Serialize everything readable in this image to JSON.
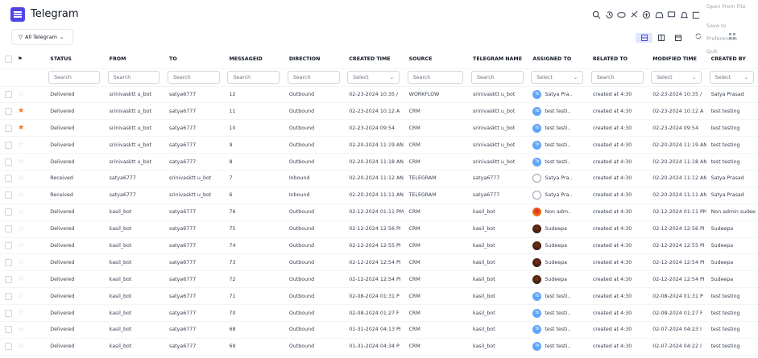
{
  "app": {
    "title": "Telegram"
  },
  "menu": {
    "items": [
      "Open From File",
      "Save to",
      "Preferences",
      "Quit"
    ]
  },
  "filter": {
    "label": "All Telegram"
  },
  "columns": [
    "STATUS",
    "FROM",
    "TO",
    "MESSAGEID",
    "DIRECTION",
    "CREATED TIME",
    "SOURCE",
    "TELEGRAM NAME",
    "ASSIGNED TO",
    "RELATED TO",
    "MODIFIED TIME",
    "CREATED BY"
  ],
  "search_row": [
    "Search",
    "Search",
    "Search",
    "Search",
    "Search",
    "Select",
    "Search",
    "Search",
    "Select",
    "Search",
    "Select",
    "Select"
  ],
  "rows": [
    {
      "starred": false,
      "avatar": "to",
      "cells": [
        "Delivered",
        "srinivasktt u_bot",
        "satya6777",
        "12",
        "Outbound",
        "02-23-2024 10:35 /",
        "WORKFLOW",
        "srinivasktt u_bot",
        "Satya Pra..",
        "created at 4:30",
        "02-23-2024 10:35 /",
        "Satya Prasad"
      ]
    },
    {
      "starred": true,
      "avatar": "to",
      "cells": [
        "Delivered",
        "srinivasktt u_bot",
        "satya6777",
        "11",
        "Outbound",
        "02-23-2024 10:12 A",
        "CRM",
        "srinivasktt u_bot",
        "test testi..",
        "created at 4:30",
        "02-23-2024 10:12 A",
        "test testing"
      ]
    },
    {
      "starred": true,
      "avatar": "to",
      "cells": [
        "Delivered",
        "srinivasktt u_bot",
        "satya6777",
        "10",
        "Outbound",
        "02-23-2024 09:54",
        "CRM",
        "srinivasktt u_bot",
        "test testi..",
        "created at 4:30",
        "02-23-2024 09:54",
        "test testing"
      ]
    },
    {
      "starred": false,
      "avatar": "to",
      "cells": [
        "Delivered",
        "srinivasktt u_bot",
        "satya6777",
        "9",
        "Outbound",
        "02-20-2024 11:19 AN",
        "CRM",
        "srinivasktt u_bot",
        "test testi..",
        "created at 4:30",
        "02-20-2024 11:19 AN",
        "test testing"
      ]
    },
    {
      "starred": false,
      "avatar": "to",
      "cells": [
        "Delivered",
        "srinivasktt u_bot",
        "satya6777",
        "8",
        "Outbound",
        "02-20-2024 11:18 AN",
        "CRM",
        "srinivasktt u_bot",
        "test testi..",
        "created at 4:30",
        "02-20-2024 11:18 AN",
        "test testing"
      ]
    },
    {
      "starred": false,
      "avatar": "pers",
      "cells": [
        "Received",
        "satya6777",
        "srinivasktt u_bot",
        "7",
        "Inbound",
        "02-20-2024 11:12 AN",
        "TELEGRAM",
        "satya6777",
        "Satya Pra..",
        "created at 4:30",
        "02-20-2024 11:12 AN",
        "Satya Prasad"
      ]
    },
    {
      "starred": false,
      "avatar": "pers",
      "cells": [
        "Received",
        "satya6777",
        "srinivasktt u_bot",
        "6",
        "Inbound",
        "02-20-2024 11:11 AN",
        "TELEGRAM",
        "satya6777",
        "Satya Pra..",
        "created at 4:30",
        "02-20-2024 11:11 AN",
        "Satya Prasad"
      ]
    },
    {
      "starred": false,
      "avatar": "orange",
      "cells": [
        "Delivered",
        "kasil_bot",
        "satya6777",
        "76",
        "Outbound",
        "02-12-2024 01:11 PM",
        "CRM",
        "kasil_bot",
        "Non adm..",
        "created at 4:30",
        "02-12-2024 01:11 PM",
        "Non admin sudee"
      ]
    },
    {
      "starred": false,
      "avatar": "dark",
      "cells": [
        "Delivered",
        "kasil_bot",
        "satya6777",
        "75",
        "Outbound",
        "02-12-2024 12:56 PI",
        "CRM",
        "kasil_bot",
        "Sudeepa",
        "created at 4:30",
        "02-12-2024 12:56 PI",
        "Sudeepa"
      ]
    },
    {
      "starred": false,
      "avatar": "dark",
      "cells": [
        "Delivered",
        "kasil_bot",
        "satya6777",
        "74",
        "Outbound",
        "02-12-2024 12:55 PI",
        "CRM",
        "kasil_bot",
        "Sudeepa",
        "created at 4:30",
        "02-12-2024 12:55 PI",
        "Sudeepa"
      ]
    },
    {
      "starred": false,
      "avatar": "dark",
      "cells": [
        "Delivered",
        "kasil_bot",
        "satya6777",
        "73",
        "Outbound",
        "02-12-2024 12:54 PI",
        "CRM",
        "kasil_bot",
        "Sudeepa",
        "created at 4:30",
        "02-12-2024 12:54 PI",
        "Sudeepa"
      ]
    },
    {
      "starred": false,
      "avatar": "dark",
      "cells": [
        "Delivered",
        "kasil_bot",
        "satya6777",
        "72",
        "Outbound",
        "02-12-2024 12:54 PI",
        "CRM",
        "kasil_bot",
        "Sudeepa",
        "created at 4:30",
        "02-12-2024 12:54 PI",
        "Sudeepa"
      ]
    },
    {
      "starred": false,
      "avatar": "to",
      "cells": [
        "Delivered",
        "kasil_bot",
        "satya6777",
        "71",
        "Outbound",
        "02-08-2024 01:31 P",
        "CRM",
        "kasil_bot",
        "test testi..",
        "created at 4:30",
        "02-08-2024 01:31 P",
        "test testing"
      ]
    },
    {
      "starred": false,
      "avatar": "to",
      "cells": [
        "Delivered",
        "kasil_bot",
        "satya6777",
        "70",
        "Outbound",
        "02-08-2024 01:27 F",
        "CRM",
        "kasil_bot",
        "test testi..",
        "created at 4:30",
        "02-08-2024 01:27 F",
        "test testing"
      ]
    },
    {
      "starred": false,
      "avatar": "to",
      "cells": [
        "Delivered",
        "kasil_bot",
        "satya6777",
        "68",
        "Outbound",
        "01-31-2024 04:13 PI",
        "CRM",
        "kasil_bot",
        "test testi..",
        "created at 4:30",
        "02-07-2024 04:23 I",
        "test testing"
      ]
    },
    {
      "starred": false,
      "avatar": "to",
      "cells": [
        "Delivered",
        "kasil_bot",
        "satya6777",
        "69",
        "Outbound",
        "01-31-2024 04:34 P",
        "CRM",
        "kasil_bot",
        "test testi..",
        "created at 4:30",
        "02-07-2024 04:22 I",
        "test testing"
      ]
    }
  ],
  "colors": {
    "accent": "#4f46e5",
    "star": "#f97316",
    "avatar_to": "#60a5fa"
  }
}
